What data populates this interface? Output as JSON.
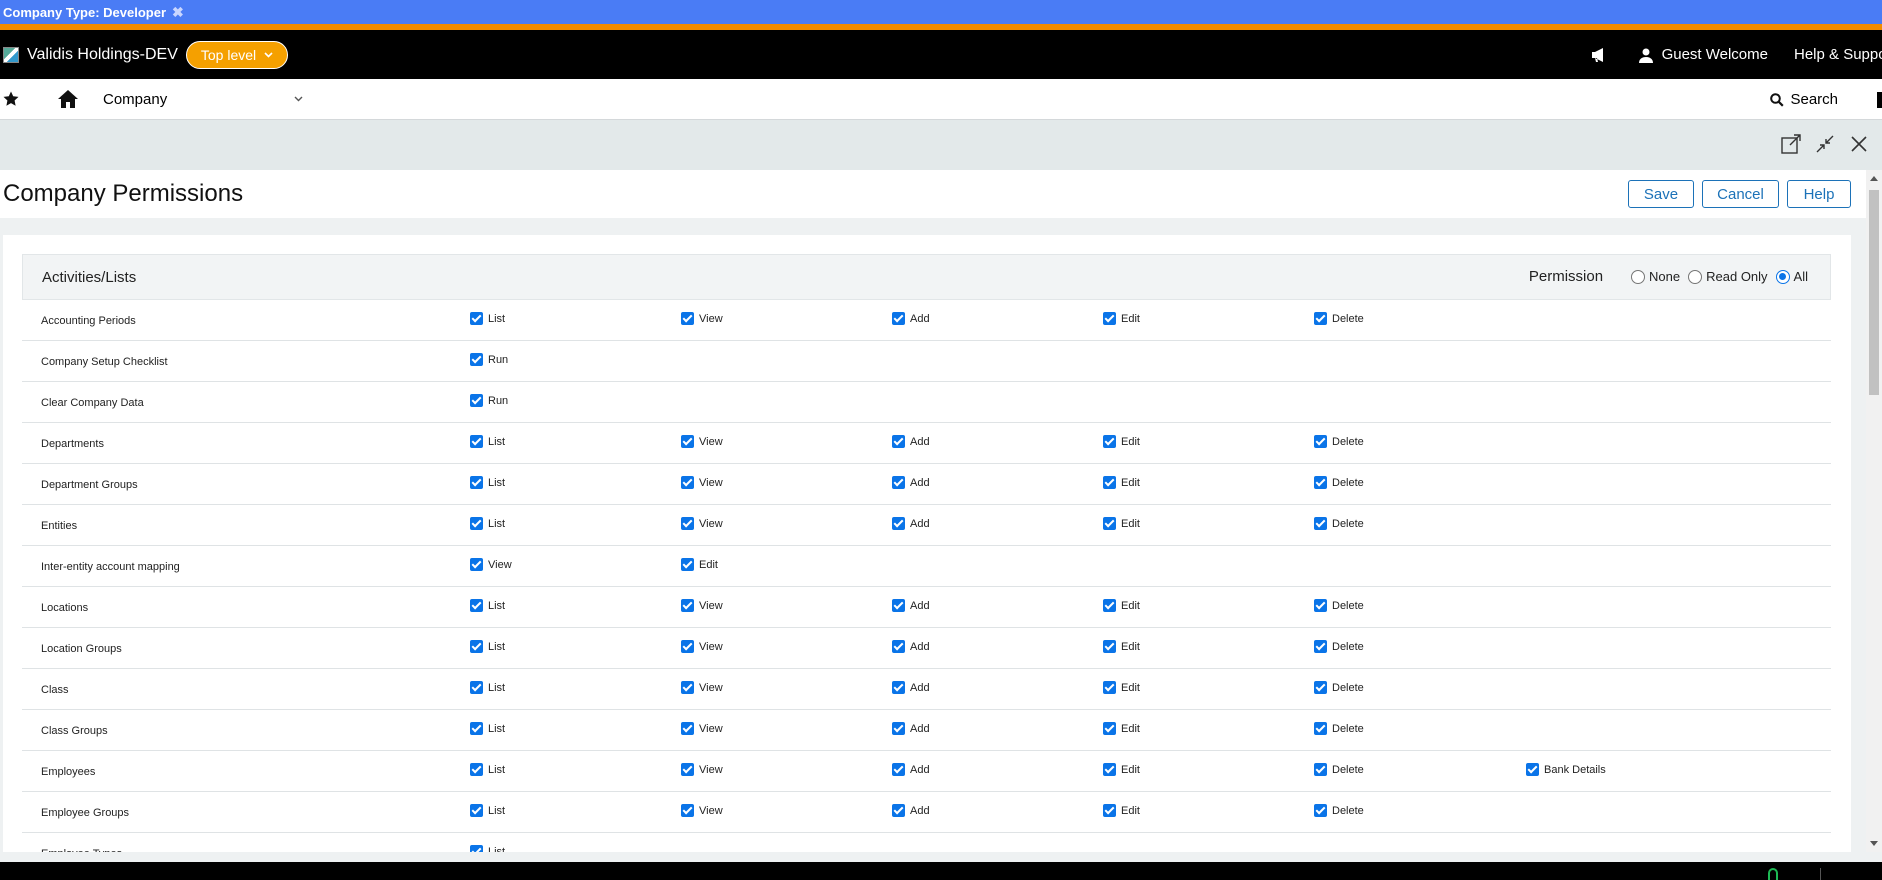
{
  "company_type_bar": {
    "label": "Company Type: Developer",
    "close": "✖"
  },
  "header": {
    "company_name": "Validis Holdings-DEV",
    "top_level_label": "Top level",
    "guest_label": "Guest Welcome",
    "help_label": "Help & Support"
  },
  "nav": {
    "company_label": "Company",
    "search_label": "Search"
  },
  "page": {
    "title": "Company Permissions",
    "save": "Save",
    "cancel": "Cancel",
    "help": "Help"
  },
  "table": {
    "header_label": "Activities/Lists",
    "permission_label": "Permission",
    "permission_options": [
      "None",
      "Read Only",
      "All"
    ],
    "permission_selected": "All",
    "rows": [
      {
        "name": "Accounting Periods",
        "perms": [
          "List",
          "View",
          "Add",
          "Edit",
          "Delete"
        ]
      },
      {
        "name": "Company Setup Checklist",
        "perms": [
          "Run"
        ]
      },
      {
        "name": "Clear Company Data",
        "perms": [
          "Run"
        ]
      },
      {
        "name": "Departments",
        "perms": [
          "List",
          "View",
          "Add",
          "Edit",
          "Delete"
        ]
      },
      {
        "name": "Department Groups",
        "perms": [
          "List",
          "View",
          "Add",
          "Edit",
          "Delete"
        ]
      },
      {
        "name": "Entities",
        "perms": [
          "List",
          "View",
          "Add",
          "Edit",
          "Delete"
        ]
      },
      {
        "name": "Inter-entity account mapping",
        "perms": [
          "View",
          "Edit"
        ]
      },
      {
        "name": "Locations",
        "perms": [
          "List",
          "View",
          "Add",
          "Edit",
          "Delete"
        ]
      },
      {
        "name": "Location Groups",
        "perms": [
          "List",
          "View",
          "Add",
          "Edit",
          "Delete"
        ]
      },
      {
        "name": "Class",
        "perms": [
          "List",
          "View",
          "Add",
          "Edit",
          "Delete"
        ]
      },
      {
        "name": "Class Groups",
        "perms": [
          "List",
          "View",
          "Add",
          "Edit",
          "Delete"
        ]
      },
      {
        "name": "Employees",
        "perms": [
          "List",
          "View",
          "Add",
          "Edit",
          "Delete",
          "Bank Details"
        ]
      },
      {
        "name": "Employee Groups",
        "perms": [
          "List",
          "View",
          "Add",
          "Edit",
          "Delete"
        ]
      },
      {
        "name": "Employee Types",
        "perms": [
          "List"
        ]
      }
    ]
  },
  "colors": {
    "type_bar": "#4a7cf5",
    "accent_orange": "#f18b00",
    "header_bg": "#000000",
    "link_blue": "#1c72b8",
    "checkbox_blue": "#0a74e8"
  },
  "icons": [
    "broken-image-icon",
    "chevron-down-icon",
    "megaphone-icon",
    "user-icon",
    "star-icon",
    "home-icon",
    "search-icon",
    "popout-icon",
    "collapse-icon",
    "close-icon"
  ]
}
